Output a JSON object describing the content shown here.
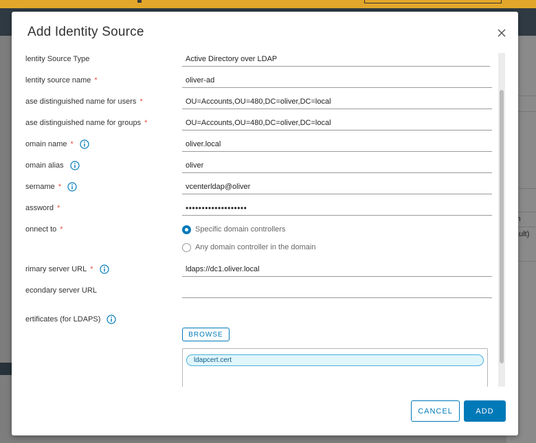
{
  "background": {
    "right_text": [
      "in",
      "ault)"
    ]
  },
  "dialog": {
    "title": "Add Identity Source",
    "fields": [
      {
        "label": "lentity Source Type",
        "value": "Active Directory over LDAP",
        "required": false,
        "info": false
      },
      {
        "label": "lentity source name",
        "value": "oliver-ad",
        "required": true,
        "info": false
      },
      {
        "label": "ase distinguished name for users",
        "value": "OU=Accounts,OU=480,DC=oliver,DC=local",
        "required": true,
        "info": false
      },
      {
        "label": "ase distinguished name for groups",
        "value": "OU=Accounts,OU=480,DC=oliver,DC=local",
        "required": true,
        "info": false
      },
      {
        "label": "omain name",
        "value": "oliver.local",
        "required": true,
        "info": true
      },
      {
        "label": "omain alias",
        "value": "oliver",
        "required": false,
        "info": true
      },
      {
        "label": "sername",
        "value": "vcenterldap@oliver",
        "required": true,
        "info": true
      },
      {
        "label": "assword",
        "value": "•••••••••••••••••••",
        "required": true,
        "info": false
      }
    ],
    "connect_to": {
      "label": "onnect to",
      "options": [
        "Specific domain controllers",
        "Any domain controller in the domain"
      ],
      "selected": 0
    },
    "primary_url": {
      "label": "rimary server URL",
      "value": "ldaps://dc1.oliver.local"
    },
    "secondary_url": {
      "label": "econdary server URL",
      "value": ""
    },
    "certificates": {
      "label": "ertificates (for LDAPS)",
      "browse_label": "BROWSE",
      "files": [
        "ldapcert.cert"
      ]
    },
    "required_mark": "*",
    "cancel_label": "CANCEL",
    "add_label": "ADD"
  }
}
